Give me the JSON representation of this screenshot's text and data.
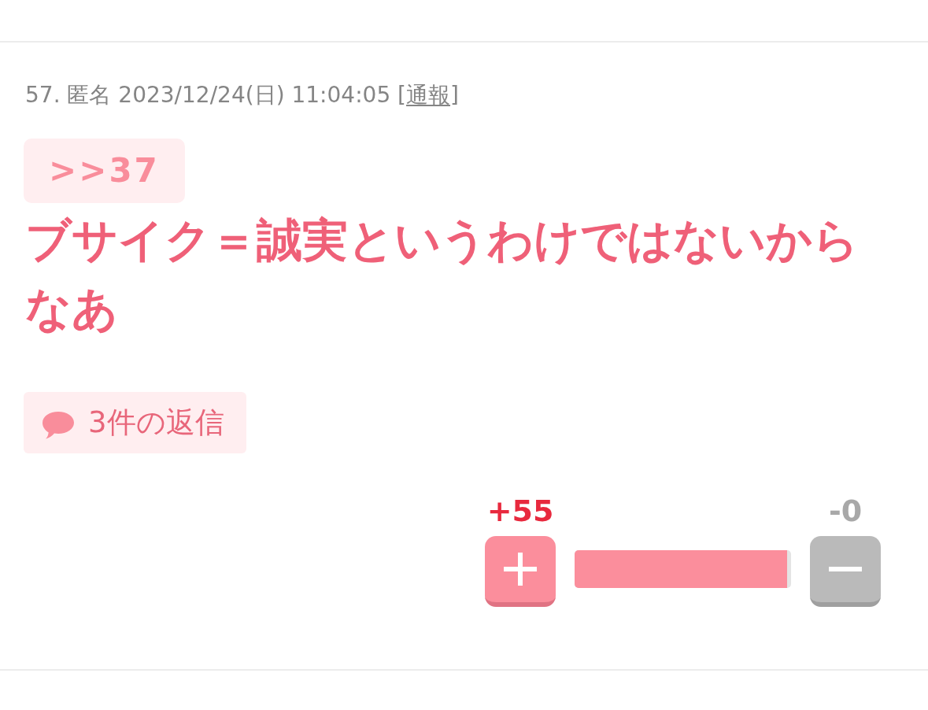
{
  "post": {
    "meta": "57. 匿名 2023/12/24(日) 11:04:05 [",
    "report_link": "通報",
    "meta_close": "]",
    "anchor": ">>37",
    "body": "ブサイク＝誠実というわけではないからなあ",
    "replies": "3件の返信"
  },
  "votes": {
    "plus": "+55",
    "minus": "-0",
    "level": 0.98
  }
}
